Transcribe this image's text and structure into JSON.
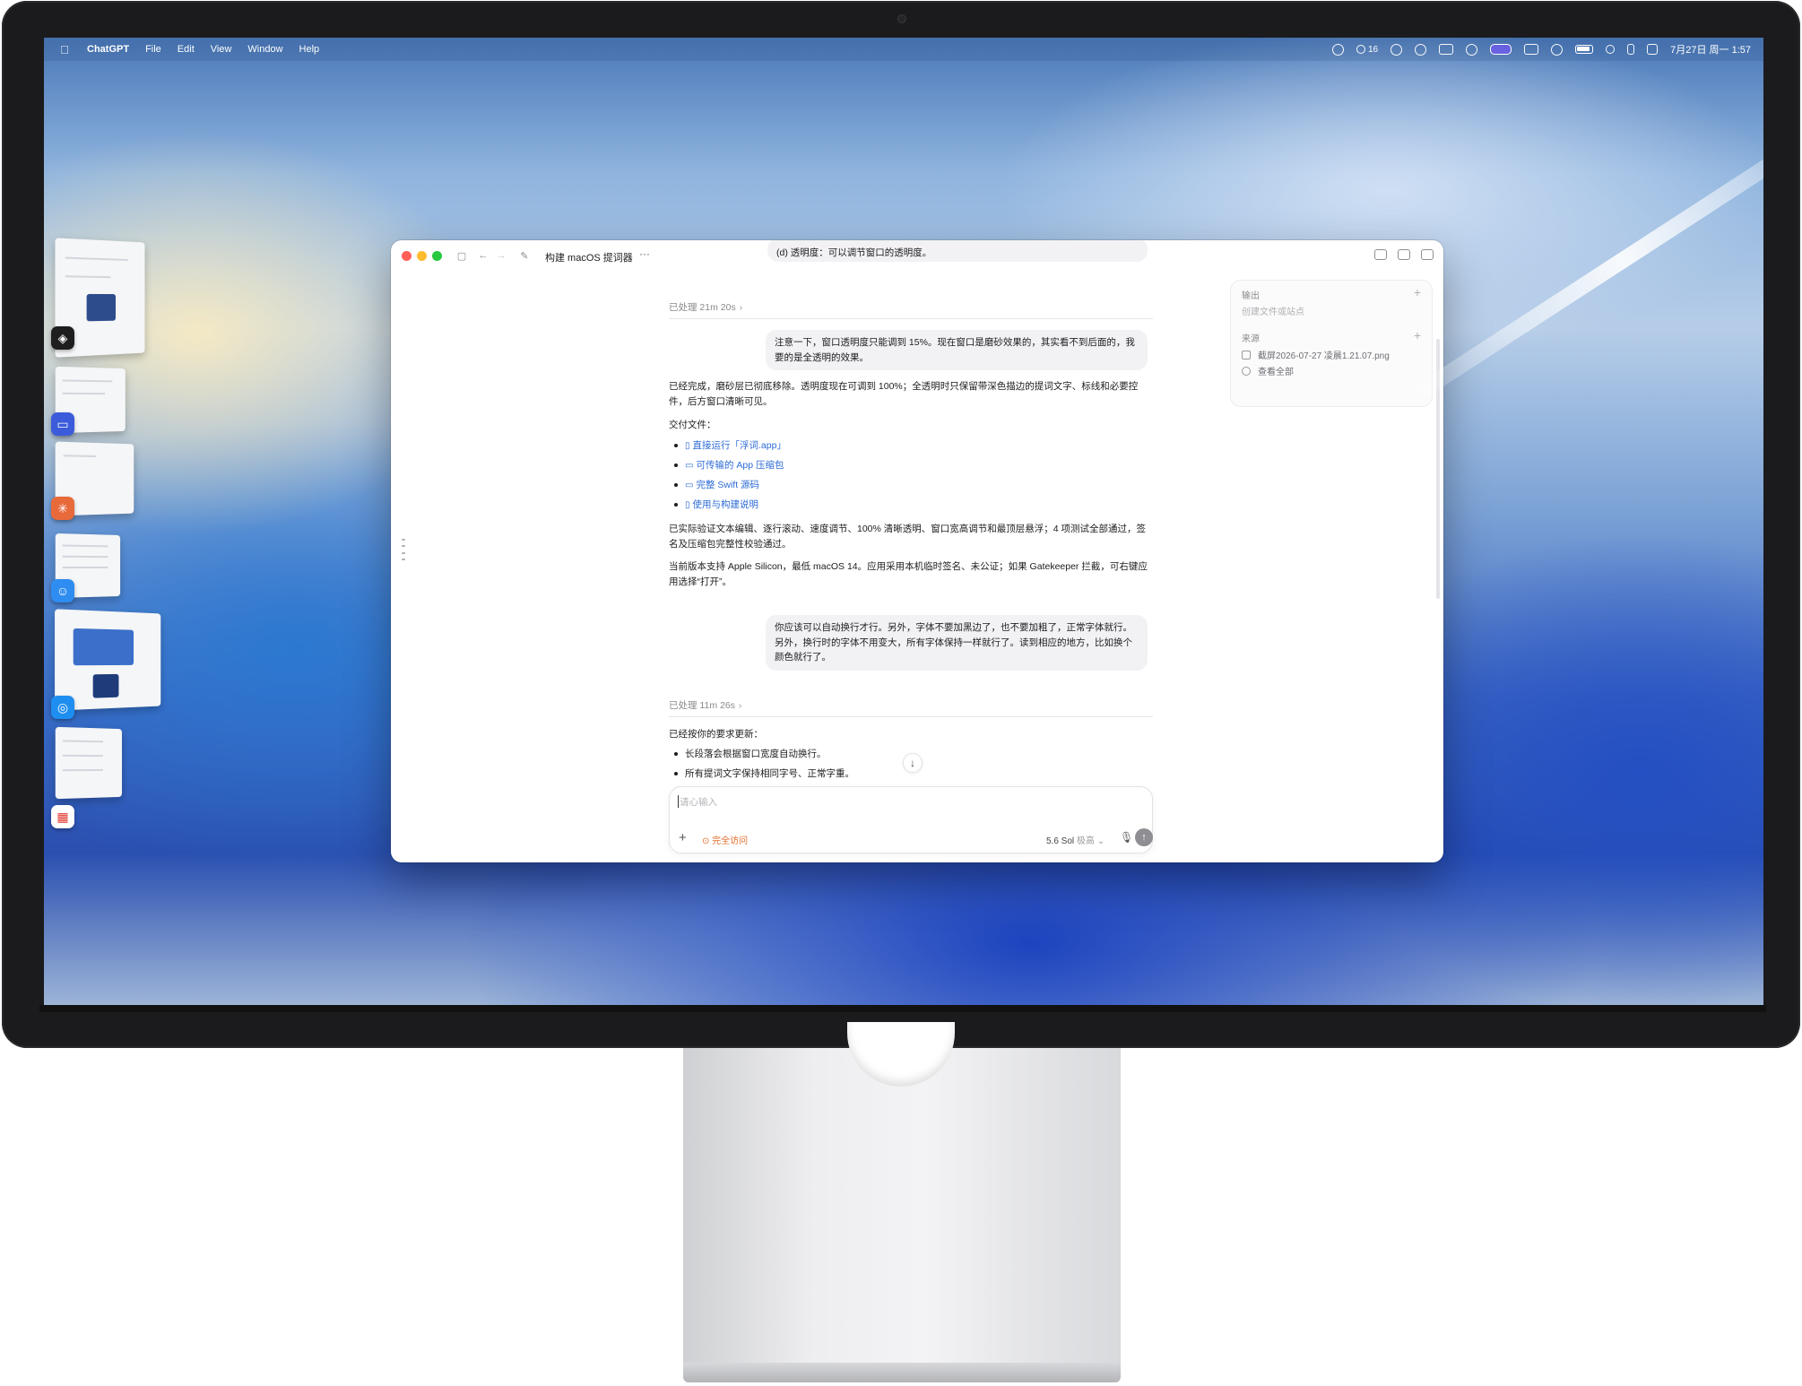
{
  "menubar": {
    "app_name": "ChatGPT",
    "menus": [
      "File",
      "Edit",
      "View",
      "Window",
      "Help"
    ],
    "status_count": "16",
    "clock": "7月27日 周一  1:57"
  },
  "window": {
    "title": "构建 macOS 提词器",
    "more": "···"
  },
  "chat": {
    "top_bubble_partial": "(d) 透明度：可以调节窗口的透明度。",
    "processed_1": "已处理 21m 20s",
    "user_msg_1": "注意一下，窗口透明度只能调到 15%。现在窗口是磨砂效果的，其实看不到后面的，我要的是全透明的效果。",
    "reply_1_p1": "已经完成，磨砂层已彻底移除。透明度现在可调到 100%；全透明时只保留带深色描边的提词文字、标线和必要控件，后方窗口清晰可见。",
    "reply_1_files_label": "交付文件：",
    "files": [
      {
        "icon": "document-icon",
        "label": "直接运行「浮词.app」"
      },
      {
        "icon": "folder-icon",
        "label": "可传输的 App 压缩包"
      },
      {
        "icon": "folder-icon",
        "label": "完整 Swift 源码"
      },
      {
        "icon": "document-icon",
        "label": "使用与构建说明"
      }
    ],
    "reply_1_p2": "已实际验证文本编辑、逐行滚动、速度调节、100% 清晰透明、窗口宽高调节和最顶层悬浮；4 项测试全部通过，签名及压缩包完整性校验通过。",
    "reply_1_p3": "当前版本支持 Apple Silicon，最低 macOS 14。应用采用本机临时签名、未公证；如果 Gatekeeper 拦截，可右键应用选择“打开”。",
    "user_msg_2": "你应该可以自动换行才行。另外，字体不要加黑边了，也不要加粗了，正常字体就行。另外，换行时的字体不用变大，所有字体保持一样就行了。读到相应的地方，比如换个颜色就行了。",
    "processed_2": "已处理 11m 26s",
    "reply_2_intro": "已经按你的要求更新：",
    "reply_2_bullets": [
      "长段落会根据窗口宽度自动换行。",
      "所有提词文字保持相同字号、正常字重。"
    ]
  },
  "composer": {
    "placeholder": "请心输入",
    "access_label": "完全访问",
    "model_label": "5.6 Sol",
    "model_effort": "极高"
  },
  "side_panel": {
    "output_header": "输出",
    "output_sub": "创建文件或站点",
    "source_header": "来源",
    "source_file": "截屏2026-07-27 凌晨1.21.07.png",
    "view_all": "查看全部"
  },
  "colors": {
    "link": "#2c6bd6",
    "access": "#e26b2a",
    "bubble": "#f2f2f4"
  }
}
